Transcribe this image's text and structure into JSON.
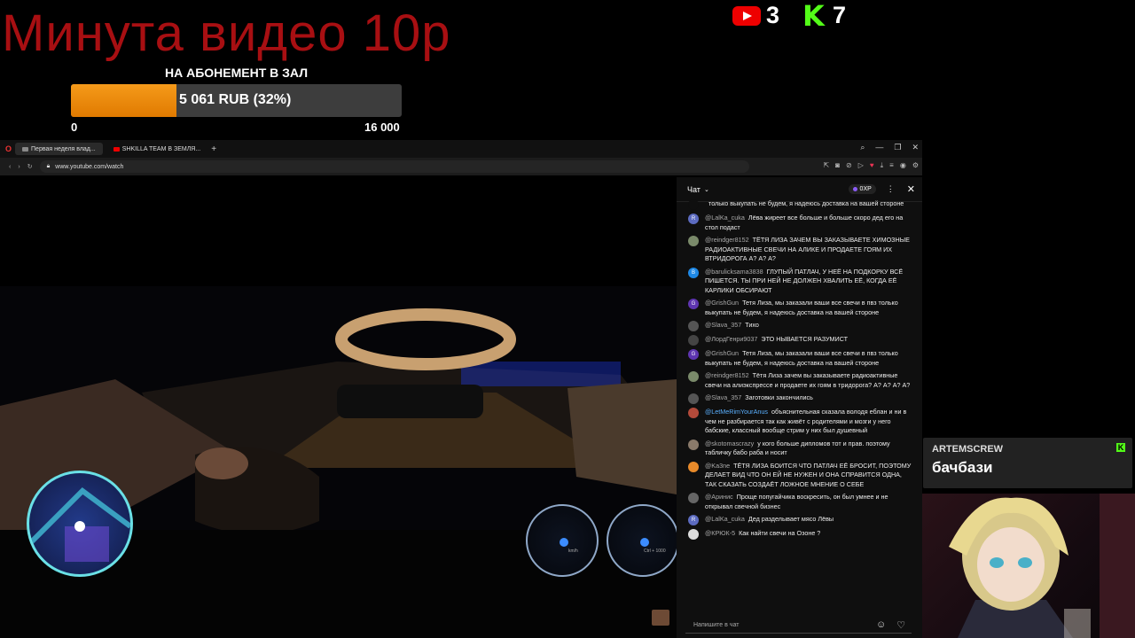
{
  "overlay": {
    "title": "Минута видео 10р",
    "goal": {
      "label": "НА АБОНЕМЕНТ В ЗАЛ",
      "progress_text": "5 061 RUB (32%)",
      "progress_fraction": 0.32,
      "min": "0",
      "max": "16 000"
    },
    "counters": {
      "youtube": "3",
      "kick": "7"
    },
    "colors": {
      "title": "#a80f12",
      "goal_fill": "#f08c0c",
      "kick": "#53fc18"
    }
  },
  "browser": {
    "tabs": [
      {
        "label": "Первая неделя влад...",
        "icon": "shield-icon"
      },
      {
        "label": "SHKILLA TEAM В ЗЕМЛЯ...",
        "icon": "youtube-icon"
      }
    ],
    "new_tab": "+",
    "url": "www.youtube.com/watch"
  },
  "chat": {
    "title": "Чат",
    "xp": "0XP",
    "input_placeholder": "Напишите в чат",
    "messages": [
      {
        "author": "",
        "text": "только выкупать не будем, я надеюсь доставка на вашей стороне",
        "avatar": "",
        "avatar_color": "#0f0f0f"
      },
      {
        "author": "@LalKa_cuka",
        "text": "Лёва жиреет все больше и больше скоро дед его на стол подаст",
        "avatar": "R",
        "avatar_color": "#5c6bc0"
      },
      {
        "author": "@reindger8152",
        "text": "ТЁТЯ ЛИЗА ЗАЧЕМ ВЫ ЗАКАЗЫВАЕТЕ ХИМОЗНЫЕ РАДИОАКТИВНЫЕ СВЕЧИ НА АЛИКЕ И ПРОДАЕТЕ ГОЯМ ИХ ВТРИДОРОГА А? А? А?",
        "avatar": "",
        "avatar_color": "#7a8a6a"
      },
      {
        "author": "@barulicksama3838",
        "text": "ГЛУПЫЙ ПАТЛАЧ, У НЕЁ НА ПОДКОРКУ ВСЁ ПИШЕТСЯ. ТЫ ПРИ НЕЙ НЕ ДОЛЖЕН ХВАЛИТЬ ЕЁ, КОГДА ЕЁ КАРЛИКИ ОБСИРАЮТ",
        "avatar": "B",
        "avatar_color": "#1e88e5"
      },
      {
        "author": "@GrishGun",
        "text": "Тетя Лиза, мы заказали ваши все свечи в пвз только выкупать не будем, я надеюсь доставка на вашей стороне",
        "avatar": "G",
        "avatar_color": "#5e35b1"
      },
      {
        "author": "@Slava_357",
        "text": "Тихо",
        "avatar": "",
        "avatar_color": "#555555"
      },
      {
        "author": "@ЛордГенри9037",
        "text": "ЭТО НЫВАЕТСЯ РАЗУМИСТ",
        "avatar": "",
        "avatar_color": "#444444"
      },
      {
        "author": "@GrishGun",
        "text": "Тетя Лиза, мы заказали ваши все свечи в пвз только выкупать не будем, я надеюсь доставка на вашей стороне",
        "avatar": "G",
        "avatar_color": "#5e35b1"
      },
      {
        "author": "@reindger8152",
        "text": "Тётя Лиза зачем вы заказываете радиоактивные свечи на алиэкспрессе и продаете их гоям в тридорога? А? А? А? А?",
        "avatar": "",
        "avatar_color": "#7a8a6a"
      },
      {
        "author": "@Slava_357",
        "text": "Заготовки закончились",
        "avatar": "",
        "avatar_color": "#555555"
      },
      {
        "author": "@LetMeRimYourAnus",
        "text": "объяснительная сказала володя еблан и ни в чем не разбирается так как живёт с родителями и мозги у него бабские, классный вообще стрим у них был душевный",
        "avatar": "",
        "avatar_color": "#b34a3a",
        "highlight": true
      },
      {
        "author": "@skotomascrazy",
        "text": "у кого больше дипломов тот и прав. поэтому табличку бабо раба и носит",
        "avatar": "",
        "avatar_color": "#8a7a6a"
      },
      {
        "author": "@Ka3ne",
        "text": "ТЁТЯ ЛИЗА БОИТСЯ ЧТО ПАТЛАЧ ЕЁ БРОСИТ, ПОЭТОМУ ДЕЛАЕТ ВИД ЧТО ОН ЕЙ НЕ НУЖЕН И ОНА СПРАВИТСЯ ОДНА, ТАК СКАЗАТЬ СОЗДАЁТ ЛОЖНОЕ МНЕНИЕ О СЕБЕ",
        "avatar": "",
        "avatar_color": "#e88a2a"
      },
      {
        "author": "@Аринис",
        "text": "Проще попугайчика воскресить, он был умнее и не открывал свечной бизнес",
        "avatar": "",
        "avatar_color": "#666666"
      },
      {
        "author": "@LalKa_cuka",
        "text": "Дед разделывает мясо Лёвы",
        "avatar": "R",
        "avatar_color": "#5c6bc0"
      },
      {
        "author": "@КРЮК-5",
        "text": "Как найти свечи на Озоне ?",
        "avatar": "",
        "avatar_color": "#dddddd"
      }
    ]
  },
  "alert": {
    "username": "ARTEMSCREW",
    "message": "бачбази"
  },
  "game_hud": {
    "gauge_left_label": "km/h",
    "gauge_right_label": "Ctrl + 1000"
  }
}
